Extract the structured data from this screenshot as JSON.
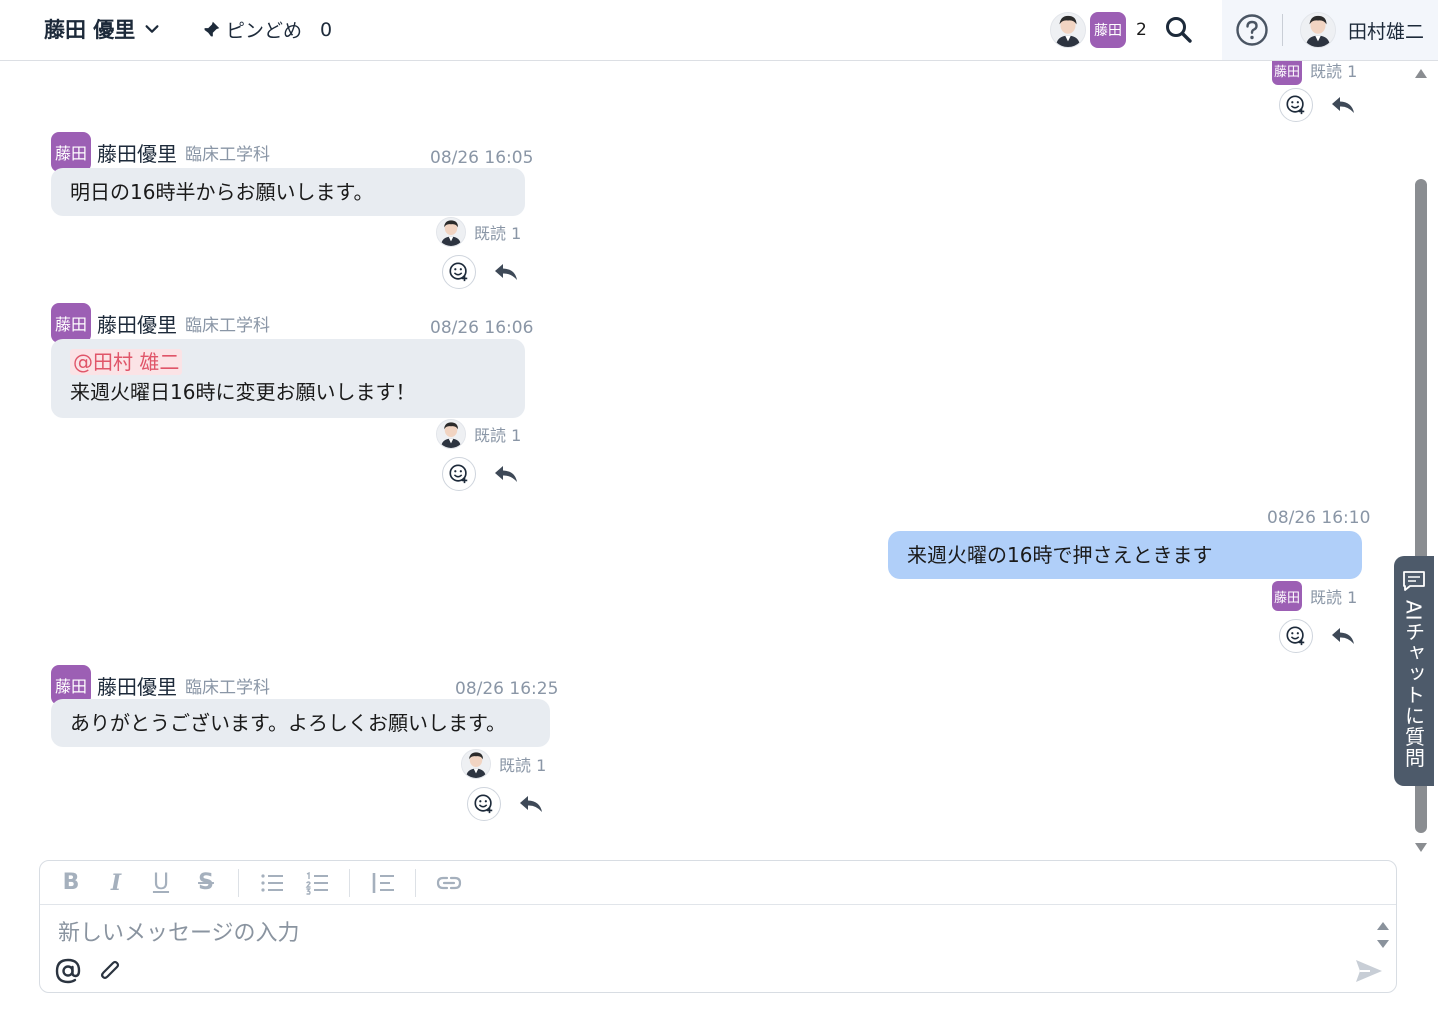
{
  "header": {
    "room_title": "藤田 優里",
    "pin_label": "ピンどめ",
    "pin_count": "0",
    "participant_avatar_text": "藤田",
    "participant_count": "2",
    "current_user": "田村雄二"
  },
  "top_partial": {
    "read_avatar_text": "藤田",
    "read_label": "既読 1"
  },
  "messages": [
    {
      "avatar_text": "藤田",
      "sender": "藤田優里",
      "dept": "臨床工学科",
      "time": "08/26 16:05",
      "text": "明日の16時半からお願いします。",
      "read_label": "既読 1"
    },
    {
      "avatar_text": "藤田",
      "sender": "藤田優里",
      "dept": "臨床工学科",
      "time": "08/26 16:06",
      "mention": "@田村 雄二",
      "text": "来週火曜日16時に変更お願いします！",
      "read_label": "既読 1"
    },
    {
      "time": "08/26 16:10",
      "text": "来週火曜の16時で押さえときます",
      "read_avatar_text": "藤田",
      "read_label": "既読 1"
    },
    {
      "avatar_text": "藤田",
      "sender": "藤田優里",
      "dept": "臨床工学科",
      "time": "08/26 16:25",
      "text": "ありがとうございます。よろしくお願いします。",
      "read_label": "既読 1"
    }
  ],
  "ai_tab": {
    "label": "AIチャットに質問"
  },
  "composer": {
    "placeholder": "新しいメッセージの入力",
    "toolbar": {
      "bold": "B",
      "italic": "I",
      "underline": "U",
      "strike": "S"
    }
  },
  "colors": {
    "avatar_purple": "#9c5fb4",
    "bubble_other": "#e8ecf1",
    "bubble_mine": "#b0cff9",
    "mention_bg": "#fbe3e6",
    "mention_text": "#e05569",
    "ai_tab_bg": "#4d5a6a"
  }
}
